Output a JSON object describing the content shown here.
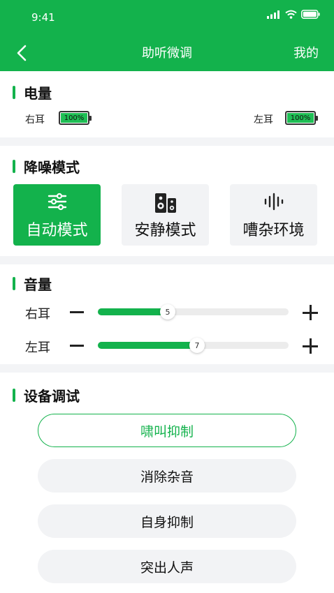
{
  "status_bar": {
    "time": "9:41"
  },
  "nav": {
    "title": "助听微调",
    "right_label": "我的"
  },
  "battery_section": {
    "title": "电量",
    "right_ear": {
      "label": "右耳",
      "level_text": "100%",
      "level": 1.0
    },
    "left_ear": {
      "label": "左耳",
      "level_text": "100%",
      "level": 1.0
    }
  },
  "noise_section": {
    "title": "降噪模式",
    "modes": [
      {
        "label": "自动模式",
        "icon": "sliders-icon",
        "active": true
      },
      {
        "label": "安静模式",
        "icon": "speaker-icon",
        "active": false
      },
      {
        "label": "嘈杂环境",
        "icon": "soundwave-icon",
        "active": false
      }
    ]
  },
  "volume_section": {
    "title": "音量",
    "max": 10,
    "rows": [
      {
        "label": "右耳",
        "value": 5
      },
      {
        "label": "左耳",
        "value": 7
      }
    ]
  },
  "debug_section": {
    "title": "设备调试",
    "buttons": [
      {
        "label": "啸叫抑制",
        "active": true
      },
      {
        "label": "消除杂音",
        "active": false
      },
      {
        "label": "自身抑制",
        "active": false
      },
      {
        "label": "突出人声",
        "active": false
      }
    ]
  },
  "colors": {
    "accent": "#13b24c",
    "battery_fill": "#1fbf55",
    "background": "#f3f4f6"
  }
}
